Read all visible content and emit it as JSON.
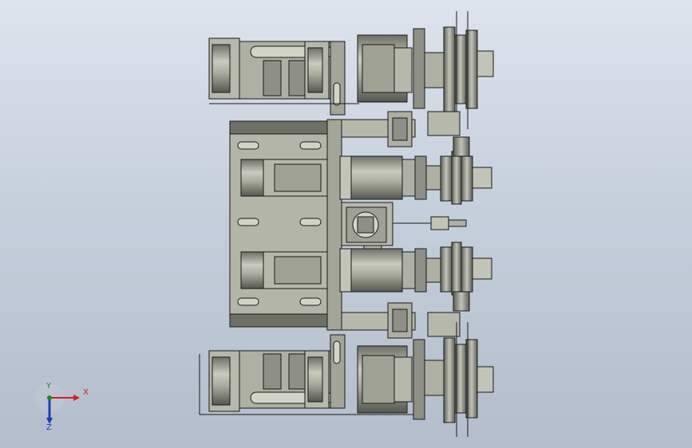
{
  "viewport": {
    "background_top": "#dde4ee",
    "background_bottom": "#b3bdcb",
    "part_color": "#a9ab9e",
    "part_shadow": "#6e7066",
    "edge_color": "#1a1a1a"
  },
  "triad": {
    "x_label": "X",
    "y_label": "Y",
    "z_label": "Z",
    "x_color": "#d42020",
    "y_color": "#1e8a22",
    "z_color": "#1f3bb8"
  }
}
